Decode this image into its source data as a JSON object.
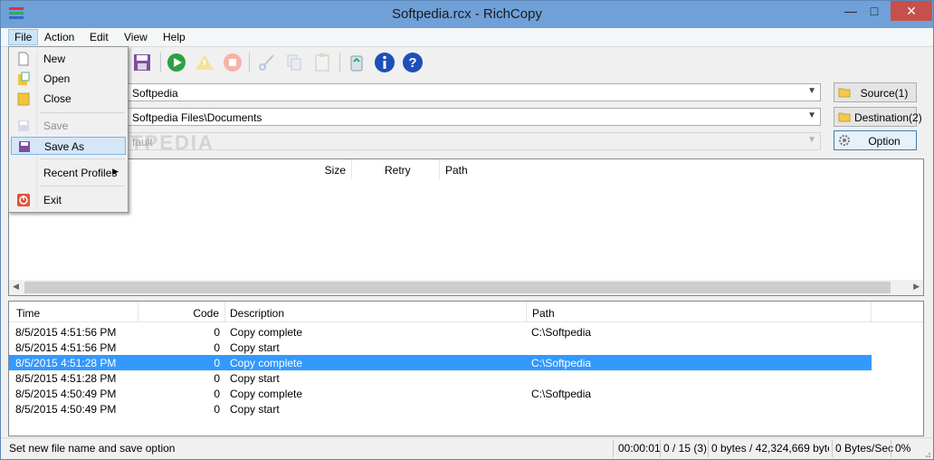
{
  "window": {
    "title": "Softpedia.rcx - RichCopy",
    "minimize": "—",
    "maximize": "□",
    "close": "✕"
  },
  "menubar": [
    "File",
    "Action",
    "Edit",
    "View",
    "Help"
  ],
  "file_menu": {
    "new": "New",
    "open": "Open",
    "close": "Close",
    "save": "Save",
    "save_as": "Save As",
    "recent_profiles": "Recent Profiles",
    "exit": "Exit"
  },
  "toolbar_icons": [
    "save-as-icon",
    "start-icon",
    "warning-icon",
    "stop-icon",
    "cut-icon",
    "copy-icon",
    "paste-icon",
    "recycle-bin-icon",
    "info-icon",
    "help-icon"
  ],
  "source": {
    "value": "Softpedia",
    "button": "Source(1)"
  },
  "destination": {
    "value": "Softpedia Files\\Documents",
    "button": "Destination(2)"
  },
  "option": {
    "value": "fault",
    "button": "Option"
  },
  "file_list": {
    "columns": [
      "Size",
      "Retry",
      "Path"
    ]
  },
  "log": {
    "columns": [
      "Time",
      "Code",
      "Description",
      "Path"
    ],
    "rows": [
      {
        "time": "8/5/2015 4:51:56 PM",
        "code": "0",
        "description": "Copy complete",
        "path": "C:\\Softpedia"
      },
      {
        "time": "8/5/2015 4:51:56 PM",
        "code": "0",
        "description": "Copy start",
        "path": ""
      },
      {
        "time": "8/5/2015 4:51:28 PM",
        "code": "0",
        "description": "Copy complete",
        "path": "C:\\Softpedia"
      },
      {
        "time": "8/5/2015 4:51:28 PM",
        "code": "0",
        "description": "Copy start",
        "path": ""
      },
      {
        "time": "8/5/2015 4:50:49 PM",
        "code": "0",
        "description": "Copy complete",
        "path": "C:\\Softpedia"
      },
      {
        "time": "8/5/2015 4:50:49 PM",
        "code": "0",
        "description": "Copy start",
        "path": ""
      }
    ],
    "selected_row": 2
  },
  "status": {
    "message": "Set new file name and save option",
    "elapsed": "00:00:01",
    "files": "0 / 15 (3)",
    "bytes": "0 bytes / 42,324,669 byte",
    "speed": "0 Bytes/Sec",
    "percent": "0%"
  },
  "watermark": "SOFTPEDIA"
}
